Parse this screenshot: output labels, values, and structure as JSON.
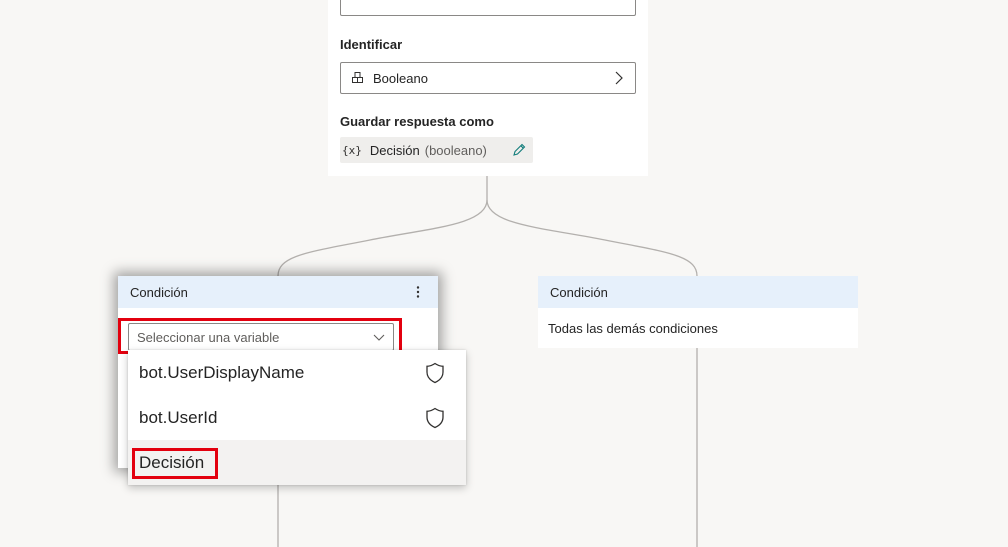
{
  "question_node": {
    "identify_label": "Identificar",
    "entity_value": "Booleano",
    "save_label": "Guardar respuesta como",
    "variable_icon_text": "{x}",
    "variable_name": "Decisión",
    "variable_type": "(booleano)"
  },
  "condition_left": {
    "title": "Condición",
    "select_placeholder": "Seleccionar una variable"
  },
  "condition_right": {
    "title": "Condición",
    "body": "Todas las demás condiciones"
  },
  "dropdown": {
    "items": [
      {
        "label": "bot.UserDisplayName",
        "icon": "shield-icon"
      },
      {
        "label": "bot.UserId",
        "icon": "shield-icon"
      },
      {
        "label": "Decisión",
        "icon": "",
        "selected": true
      }
    ]
  },
  "colors": {
    "canvas_bg": "#f8f7f5",
    "condition_header_bg": "#e6f0fb",
    "highlight_red": "#e3000f",
    "connector": "#b3b0ad"
  }
}
